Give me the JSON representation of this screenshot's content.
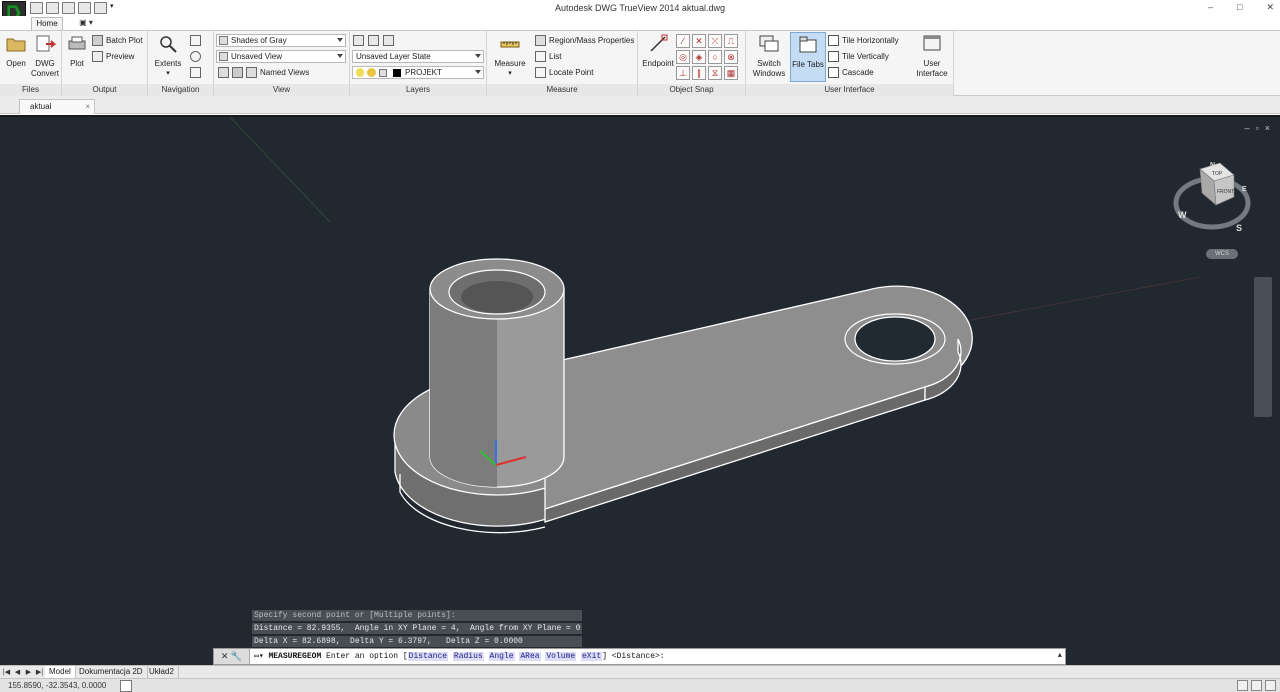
{
  "app": {
    "title": "Autodesk DWG TrueView 2014    aktual.dwg",
    "window_controls": [
      "–",
      "□",
      "✕"
    ]
  },
  "ribbon": {
    "tabs": [
      "Home",
      "▣ ▾"
    ],
    "panels": {
      "files": {
        "label": "Files",
        "open": "Open",
        "dwg_convert_1": "DWG",
        "dwg_convert_2": "Convert"
      },
      "output": {
        "label": "Output",
        "plot": "Plot",
        "batch_plot": "Batch Plot",
        "preview": "Preview"
      },
      "navigation": {
        "label": "Navigation",
        "extents": "Extents"
      },
      "view": {
        "label": "View",
        "visual_style": "Shades of Gray",
        "saved_view": "Unsaved View",
        "named_views": "Named Views"
      },
      "layers": {
        "label": "Layers",
        "layer_state": "Unsaved Layer State",
        "current_layer": "PROJEKT"
      },
      "measure": {
        "label": "Measure",
        "measure": "Measure",
        "region_mass": "Region/Mass Properties",
        "list": "List",
        "locate_point": "Locate Point"
      },
      "object_snap": {
        "label": "Object Snap",
        "endpoint": "Endpoint"
      },
      "user_interface": {
        "label": "User Interface",
        "switch_windows_1": "Switch",
        "switch_windows_2": "Windows",
        "file_tabs": "File Tabs",
        "tile_horizontally": "Tile Horizontally",
        "tile_vertically": "Tile Vertically",
        "cascade": "Cascade",
        "ui_1": "User",
        "ui_2": "Interface"
      }
    }
  },
  "file_tab": {
    "name": "aktual",
    "close": "×"
  },
  "viewport": {
    "controls": [
      "–",
      "▫",
      "×"
    ],
    "viewcube": {
      "top": "TOP",
      "front": "FRONT",
      "compass": [
        "N",
        "E",
        "S",
        "W"
      ]
    },
    "wcs": "WCS"
  },
  "command_history": [
    "Specify second point or [Multiple points]:",
    "Distance = 82.9355,  Angle in XY Plane = 4,  Angle from XY Plane = 0",
    "Delta X = 82.6898,  Delta Y = 6.3797,   Delta Z = 0.0000"
  ],
  "command_line": {
    "command": "MEASUREGEOM",
    "prompt": " Enter an option [",
    "options": [
      "Distance",
      "Radius",
      "Angle",
      "ARea",
      "Volume",
      "eXit"
    ],
    "suffix": "] <Distance>:"
  },
  "layout_tabs": [
    "Model",
    "Dokumentacja 2D",
    "Układ2"
  ],
  "status": {
    "coords": "155.8590, -32.3543, 0.0000"
  },
  "colors": {
    "viewport_bg": "#212830",
    "model_face": "#8e8e8e",
    "model_edge": "#ffffff"
  }
}
